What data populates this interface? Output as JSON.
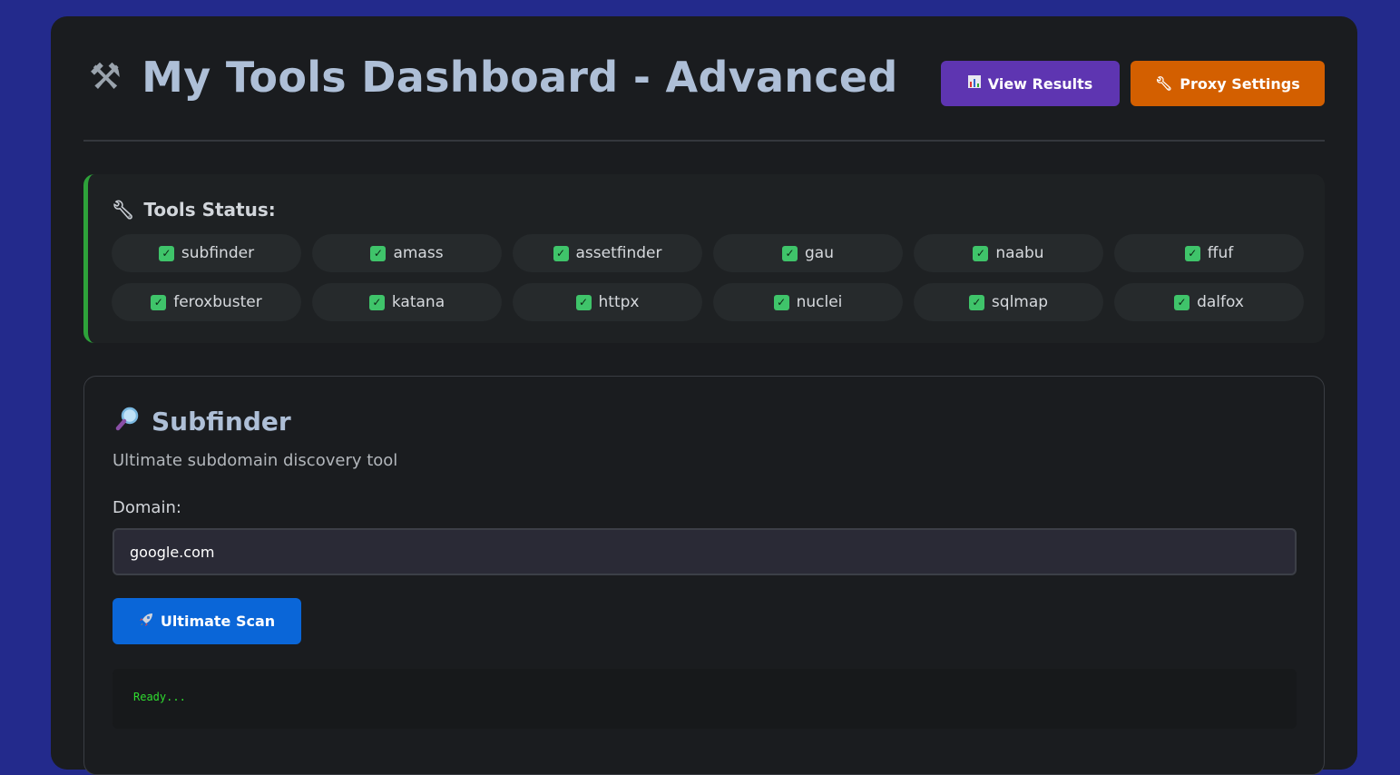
{
  "header": {
    "icon": "hammer-wrench-icon",
    "title": "My Tools Dashboard - Advanced",
    "view_results": {
      "icon": "bar-chart-icon",
      "label": "View Results"
    },
    "proxy_settings": {
      "icon": "wrench-icon",
      "label": "Proxy Settings"
    }
  },
  "status": {
    "icon": "wrench-icon",
    "title": "Tools Status:",
    "tools": [
      {
        "name": "subfinder",
        "ok": true
      },
      {
        "name": "amass",
        "ok": true
      },
      {
        "name": "assetfinder",
        "ok": true
      },
      {
        "name": "gau",
        "ok": true
      },
      {
        "name": "naabu",
        "ok": true
      },
      {
        "name": "ffuf",
        "ok": true
      },
      {
        "name": "feroxbuster",
        "ok": true
      },
      {
        "name": "katana",
        "ok": true
      },
      {
        "name": "httpx",
        "ok": true
      },
      {
        "name": "nuclei",
        "ok": true
      },
      {
        "name": "sqlmap",
        "ok": true
      },
      {
        "name": "dalfox",
        "ok": true
      }
    ]
  },
  "tool_card": {
    "icon": "magnifier-icon",
    "title": "Subfinder",
    "description": "Ultimate subdomain discovery tool",
    "field_label": "Domain:",
    "field_value": "google.com",
    "scan_button": {
      "icon": "rocket-icon",
      "label": "Ultimate Scan"
    },
    "output": "Ready..."
  },
  "colors": {
    "page_background": "#232a8c",
    "panel": "#1a1c1f",
    "view_results_button": "#5e35b1",
    "proxy_button": "#d35f00",
    "scan_button": "#0a66d8",
    "status_accent": "#2ea23a",
    "output_text": "#2fdc2f"
  }
}
